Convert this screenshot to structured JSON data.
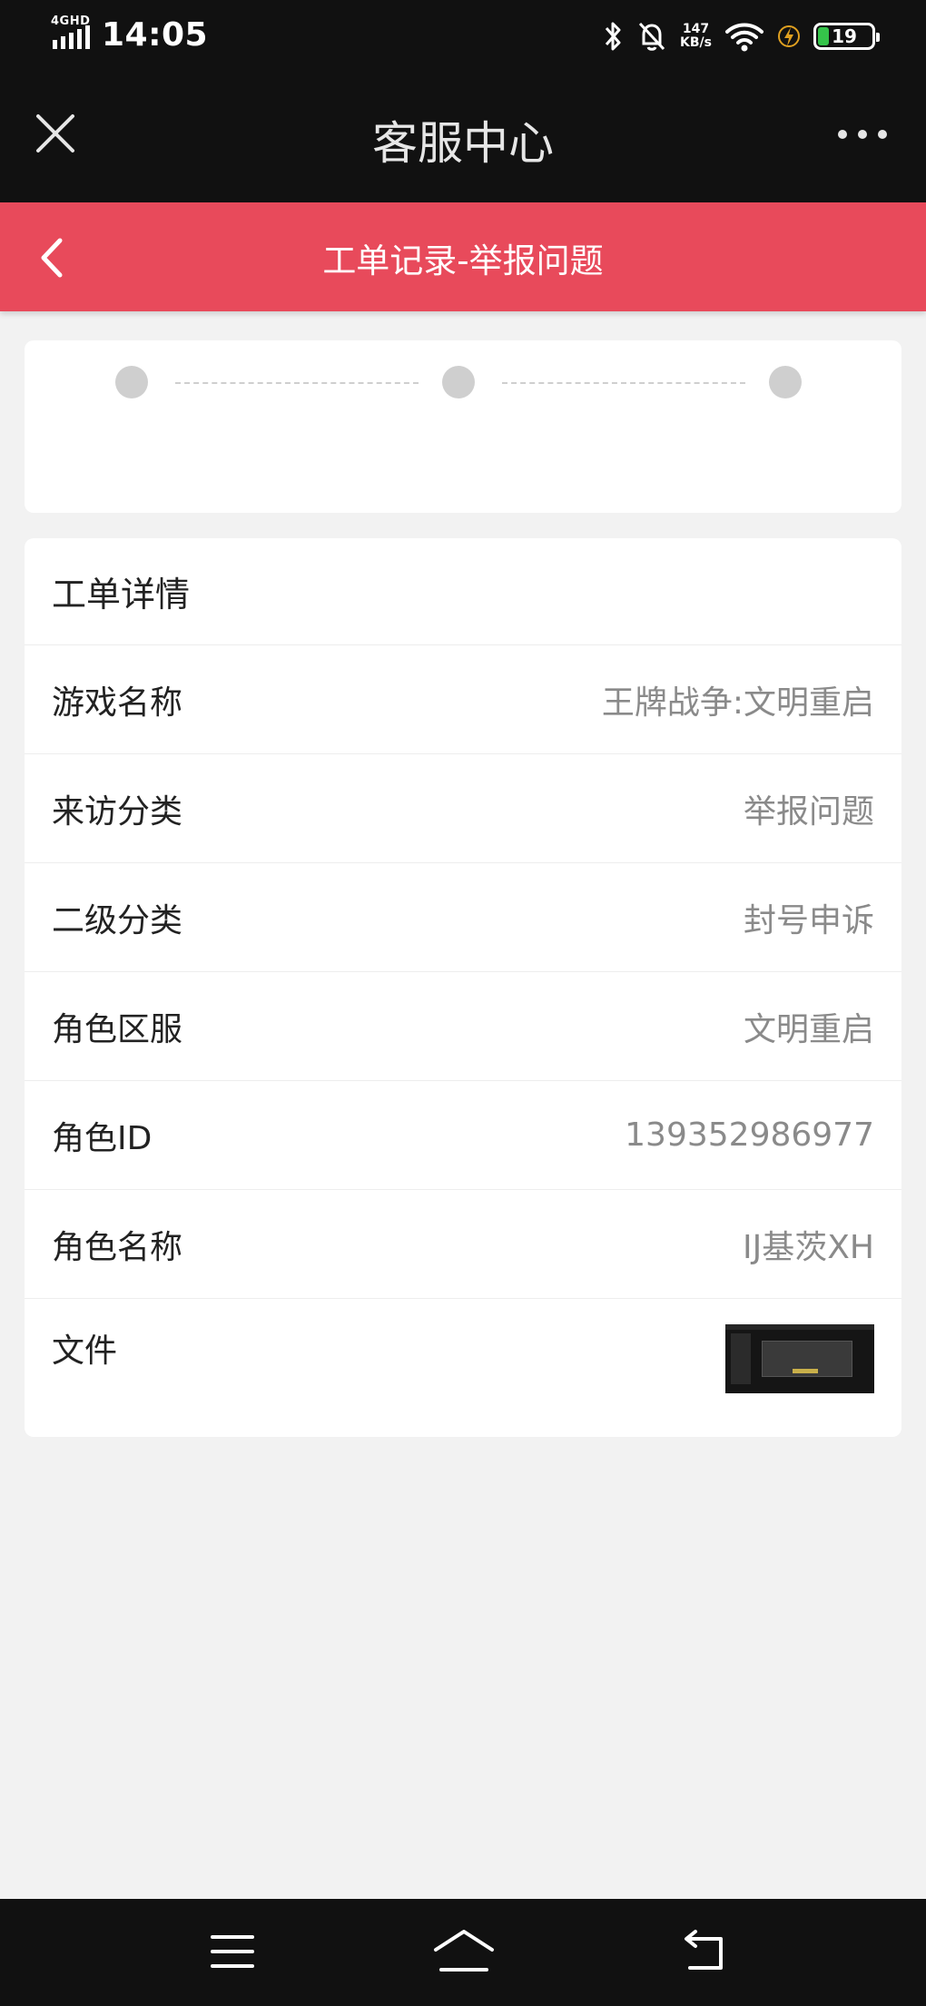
{
  "status_bar": {
    "network": "4GHD",
    "time": "14:05",
    "speed_value": "147",
    "speed_unit": "KB/s",
    "battery_level": "19",
    "battery_color": "#35c44a"
  },
  "title_bar": {
    "title": "客服中心",
    "close_icon": "close-icon",
    "more_icon": "more-icon"
  },
  "sub_header": {
    "title": "工单记录-举报问题",
    "back_icon": "chevron-left-icon",
    "background_color": "#e84a5b"
  },
  "progress": {
    "steps": 3
  },
  "detail": {
    "heading": "工单详情",
    "rows": [
      {
        "label": "游戏名称",
        "value": "王牌战争:文明重启"
      },
      {
        "label": "来访分类",
        "value": "举报问题"
      },
      {
        "label": "二级分类",
        "value": "封号申诉"
      },
      {
        "label": "角色区服",
        "value": "文明重启"
      },
      {
        "label": "角色ID",
        "value": "139352986977"
      },
      {
        "label": "角色名称",
        "value": "IJ基茨XH"
      }
    ],
    "file_label": "文件"
  },
  "nav_bar": {
    "icons": [
      "menu-icon",
      "home-icon",
      "back-icon"
    ]
  }
}
